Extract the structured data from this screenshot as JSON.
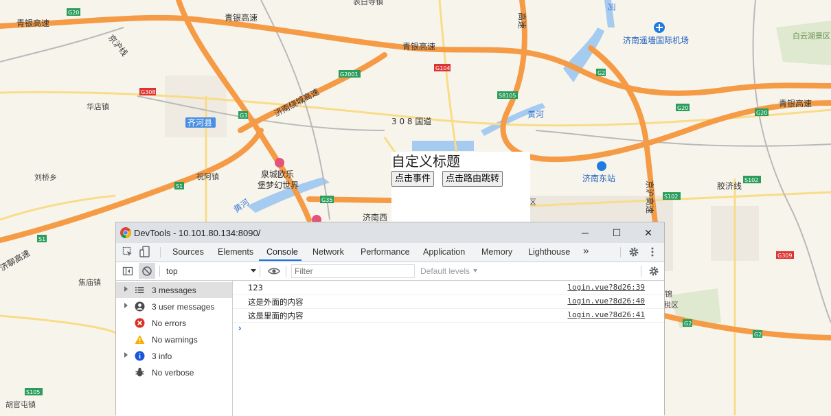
{
  "map": {
    "labels": {
      "qingyin_1": "青银高速",
      "qingyin_2": "青银高速",
      "qingyin_3": "青银高速",
      "qingyin_4": "青银高速",
      "jinghu": "京沪线",
      "jinan_rao": "济南绕城高速",
      "road_308": "3 0 8 国道",
      "huadian": "华店镇",
      "qihe": "齐河县",
      "liuqiao": "刘桥乡",
      "zhuahe": "祝阿镇",
      "quancheng": "泉城欧乐",
      "dreamworld": "堡梦幻世界",
      "yellow_river_1": "黄河",
      "yellow_river_2": "黄河",
      "jinan_west": "济南西",
      "jinan_east": "济南东站",
      "airport": "济南遥墙国际机场",
      "baiyun": "白云湖景区",
      "jiaoji": "胶济线",
      "jinghu_express": "京沪高速",
      "jiaozhuang": "焦庙镇",
      "hutun": "胡官屯镇",
      "jinliao": "济聊高速",
      "sutang": "表白寺镇",
      "speed_top": "高速",
      "he_top": "河",
      "jin_r": "锦",
      "tax_r": "税区",
      "qu": "区"
    },
    "shields": {
      "g20_a": "G20",
      "g20_b": "G20",
      "g20_c": "G20",
      "g2001": "G2001",
      "g104": "G104",
      "g308": "G308",
      "g3": "G3",
      "s8105": "S8105",
      "g2_a": "G2",
      "g2_b": "G2",
      "g2_c": "G2",
      "g35": "G35",
      "s1_a": "S1",
      "s1_b": "S1",
      "s102_a": "S102",
      "s102_b": "S102",
      "g309": "G309",
      "s105": "S105"
    }
  },
  "app": {
    "title": "自定义标题",
    "click_event_button": "点击事件",
    "route_jump_button": "点击路由跳转"
  },
  "devtools": {
    "window_title": "DevTools - 10.101.80.134:8090/",
    "window_controls": {
      "minimize": "─",
      "maximize": "☐",
      "close": "✕"
    },
    "tabs": [
      "Sources",
      "Elements",
      "Console",
      "Network",
      "Performance",
      "Application",
      "Memory",
      "Lighthouse"
    ],
    "more_tabs": "»",
    "context_select": "top",
    "filter_placeholder": "Filter",
    "levels": "Default levels",
    "sidebar": [
      {
        "label": "3 messages",
        "icon": "list-icon",
        "expandable": true
      },
      {
        "label": "3 user messages",
        "icon": "user-icon",
        "expandable": true
      },
      {
        "label": "No errors",
        "icon": "error-icon",
        "expandable": false
      },
      {
        "label": "No warnings",
        "icon": "warning-icon",
        "expandable": false
      },
      {
        "label": "3 info",
        "icon": "info-icon",
        "expandable": true
      },
      {
        "label": "No verbose",
        "icon": "verbose-icon",
        "expandable": false
      }
    ],
    "logs": [
      {
        "message": "123",
        "source": "login.vue?8d26:39"
      },
      {
        "message": "这是外面的内容",
        "source": "login.vue?8d26:40"
      },
      {
        "message": "这是里面的内容",
        "source": "login.vue?8d26:41"
      }
    ],
    "prompt": "›"
  },
  "colors": {
    "highway": "#f59b46",
    "water": "#a6cbf0",
    "tab_active": "#1a73e8",
    "error": "#d93025",
    "warning": "#f9ab00",
    "info": "#1a56db"
  }
}
